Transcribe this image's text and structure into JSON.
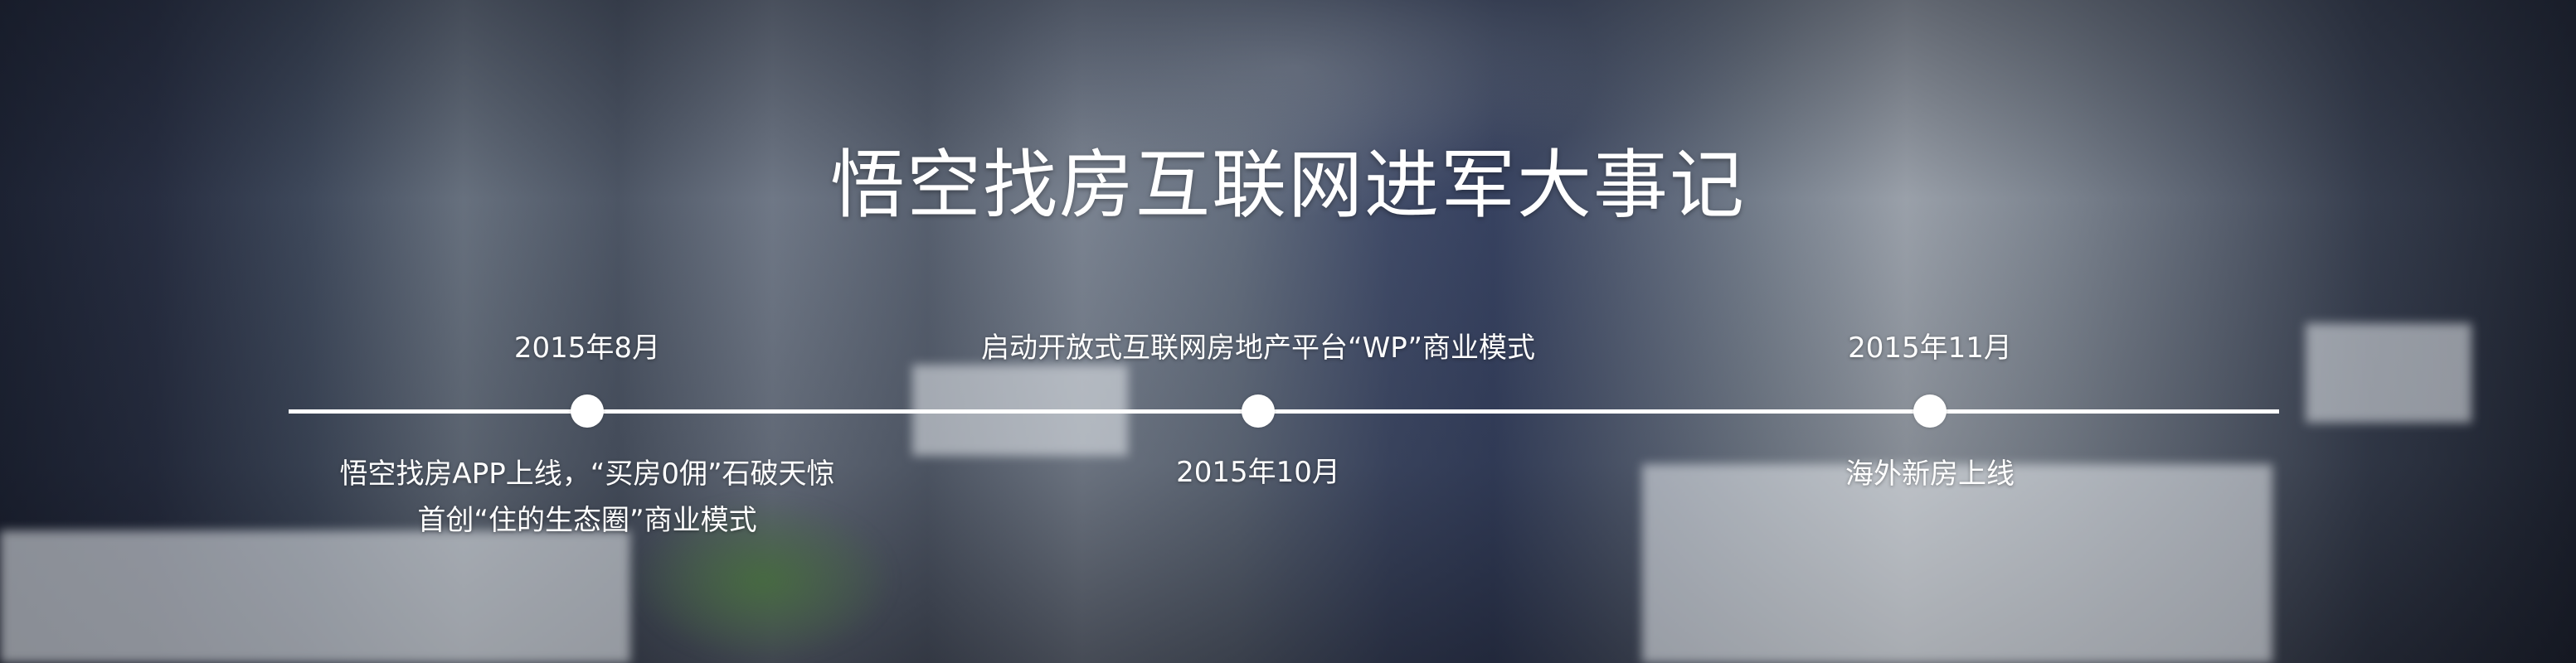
{
  "banner": {
    "title": "悟空找房互联网进军大事记"
  },
  "timeline": {
    "events": [
      {
        "date": "2015年8月",
        "description_line1": "悟空找房APP上线，“买房0佣”石破天惊",
        "description_line2": "首创“住的生态圈”商业模式"
      },
      {
        "date": "2015年10月",
        "description_line1": "启动开放式互联网房地产平台“WP”商业模式"
      },
      {
        "date": "2015年11月",
        "description_line1": "海外新房上线"
      }
    ]
  }
}
